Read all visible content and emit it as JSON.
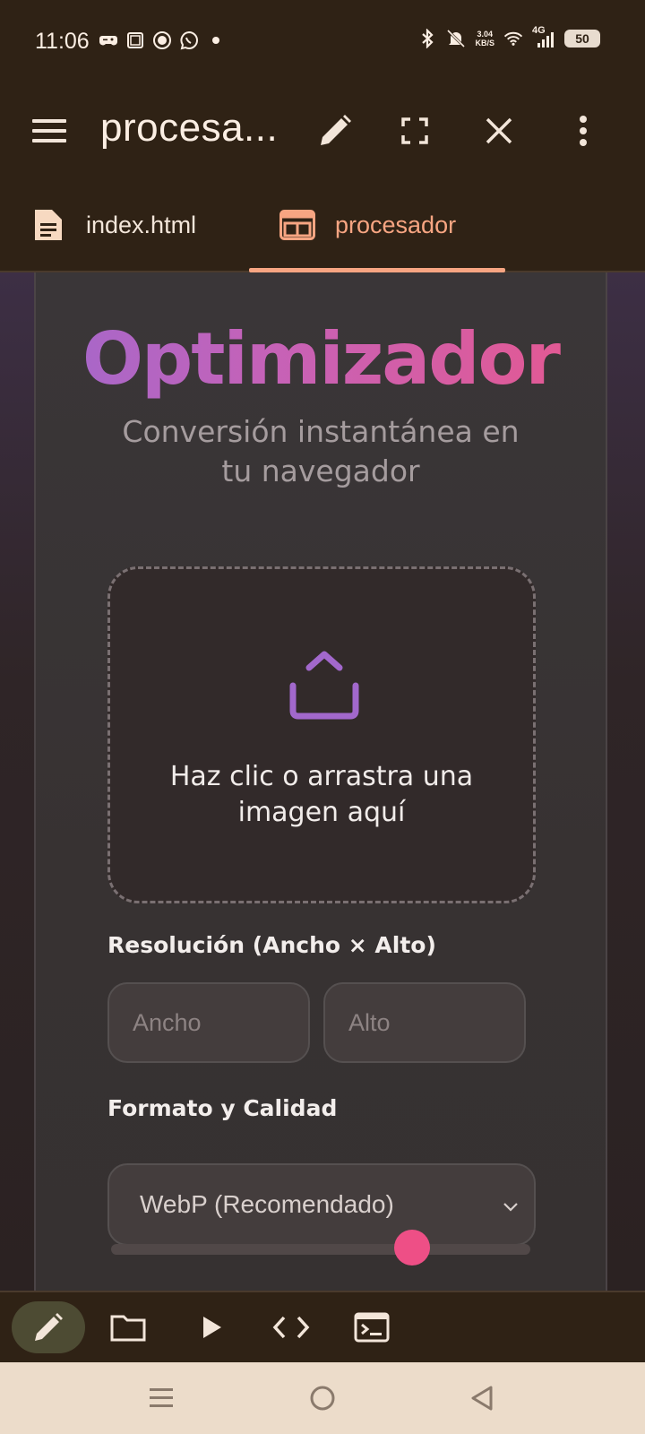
{
  "status_bar": {
    "time": "11:06",
    "net_speed_value": "3.04",
    "net_speed_unit": "KB/S",
    "network": "4G",
    "battery": "50",
    "icons_left": [
      "game-controller-icon",
      "screenshot-icon",
      "record-icon",
      "whatsapp-icon",
      "dot-icon"
    ],
    "icons_right": [
      "bluetooth-icon",
      "mute-icon",
      "wifi-icon",
      "signal-icon"
    ]
  },
  "toolbar": {
    "title": "procesa...",
    "icons": [
      "menu-icon",
      "pencil-icon",
      "fullscreen-icon",
      "close-icon",
      "more-vert-icon"
    ]
  },
  "tabs": [
    {
      "label": "index.html",
      "icon": "document-icon",
      "active": false
    },
    {
      "label": "procesador",
      "icon": "web-layout-icon",
      "active": true
    }
  ],
  "app": {
    "title": "Optimizador",
    "subtitle": "Conversión instantánea en tu navegador",
    "dropzone_text": "Haz clic o arrastra una imagen aquí",
    "resolution_label": "Resolución (Ancho × Alto)",
    "width_placeholder": "Ancho",
    "height_placeholder": "Alto",
    "format_label": "Formato y Calidad",
    "format_selected": "WebP (Recomendado)",
    "quality_fraction": 0.75,
    "colors": {
      "title_start": "#a268cc",
      "title_end": "#e6588f",
      "accent": "#ee4f86"
    }
  },
  "action_bar": {
    "buttons": [
      "edit-icon",
      "folder-icon",
      "play-icon",
      "code-icon",
      "terminal-icon"
    ],
    "active": "edit-icon"
  },
  "nav_bar": {
    "buttons": [
      "recents-icon",
      "home-icon",
      "back-icon"
    ]
  }
}
